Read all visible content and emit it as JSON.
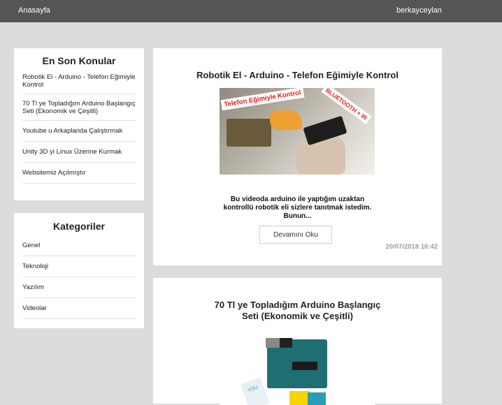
{
  "navbar": {
    "home_label": "Anasayfa",
    "user_label": "berkayceylan",
    "background": "#555555"
  },
  "recent": {
    "title": "En Son Konular",
    "items": [
      "Robotik El - Arduino - Telefon Eğimiyle Kontrol",
      "70 Tl ye Topladığım Arduino Başlangıç Seti (Ekonomik ve Çeşitli)",
      "Youtube u Arkaplanda Çalıştırmak",
      "Unity 3D yi Linux Üzerine Kurmak",
      "Websitemiz Açılmıştır"
    ]
  },
  "categories": {
    "title": "Kategoriler",
    "items": [
      "Genel",
      "Teknoloji",
      "Yazılım",
      "Videolar"
    ]
  },
  "posts": [
    {
      "title": "Robotik El - Arduino - Telefon Eğimiyle Kontrol",
      "image_text_1": "Telefon Eğimiyle Kontrol",
      "image_text_2": "BLUETOOTH + IR",
      "excerpt_lines": [
        "Bu videoda arduino ile yaptığım uzaktan",
        "kontrollü robotik eli sizlere tanıtmak istedim.",
        "Bunun..."
      ],
      "read_more_label": "Devamını Oku",
      "date": "20/07/2018 16:42"
    },
    {
      "title": "70 Tl ye Topladığım Arduino Başlangıç Seti (Ekonomik ve Çeşitli)",
      "image_text": "YOU"
    }
  ],
  "colors": {
    "page_background": "#dcdcdc",
    "card_background": "#ffffff",
    "accent_red": "#e2231a",
    "date_gray": "#9a9a9a"
  }
}
